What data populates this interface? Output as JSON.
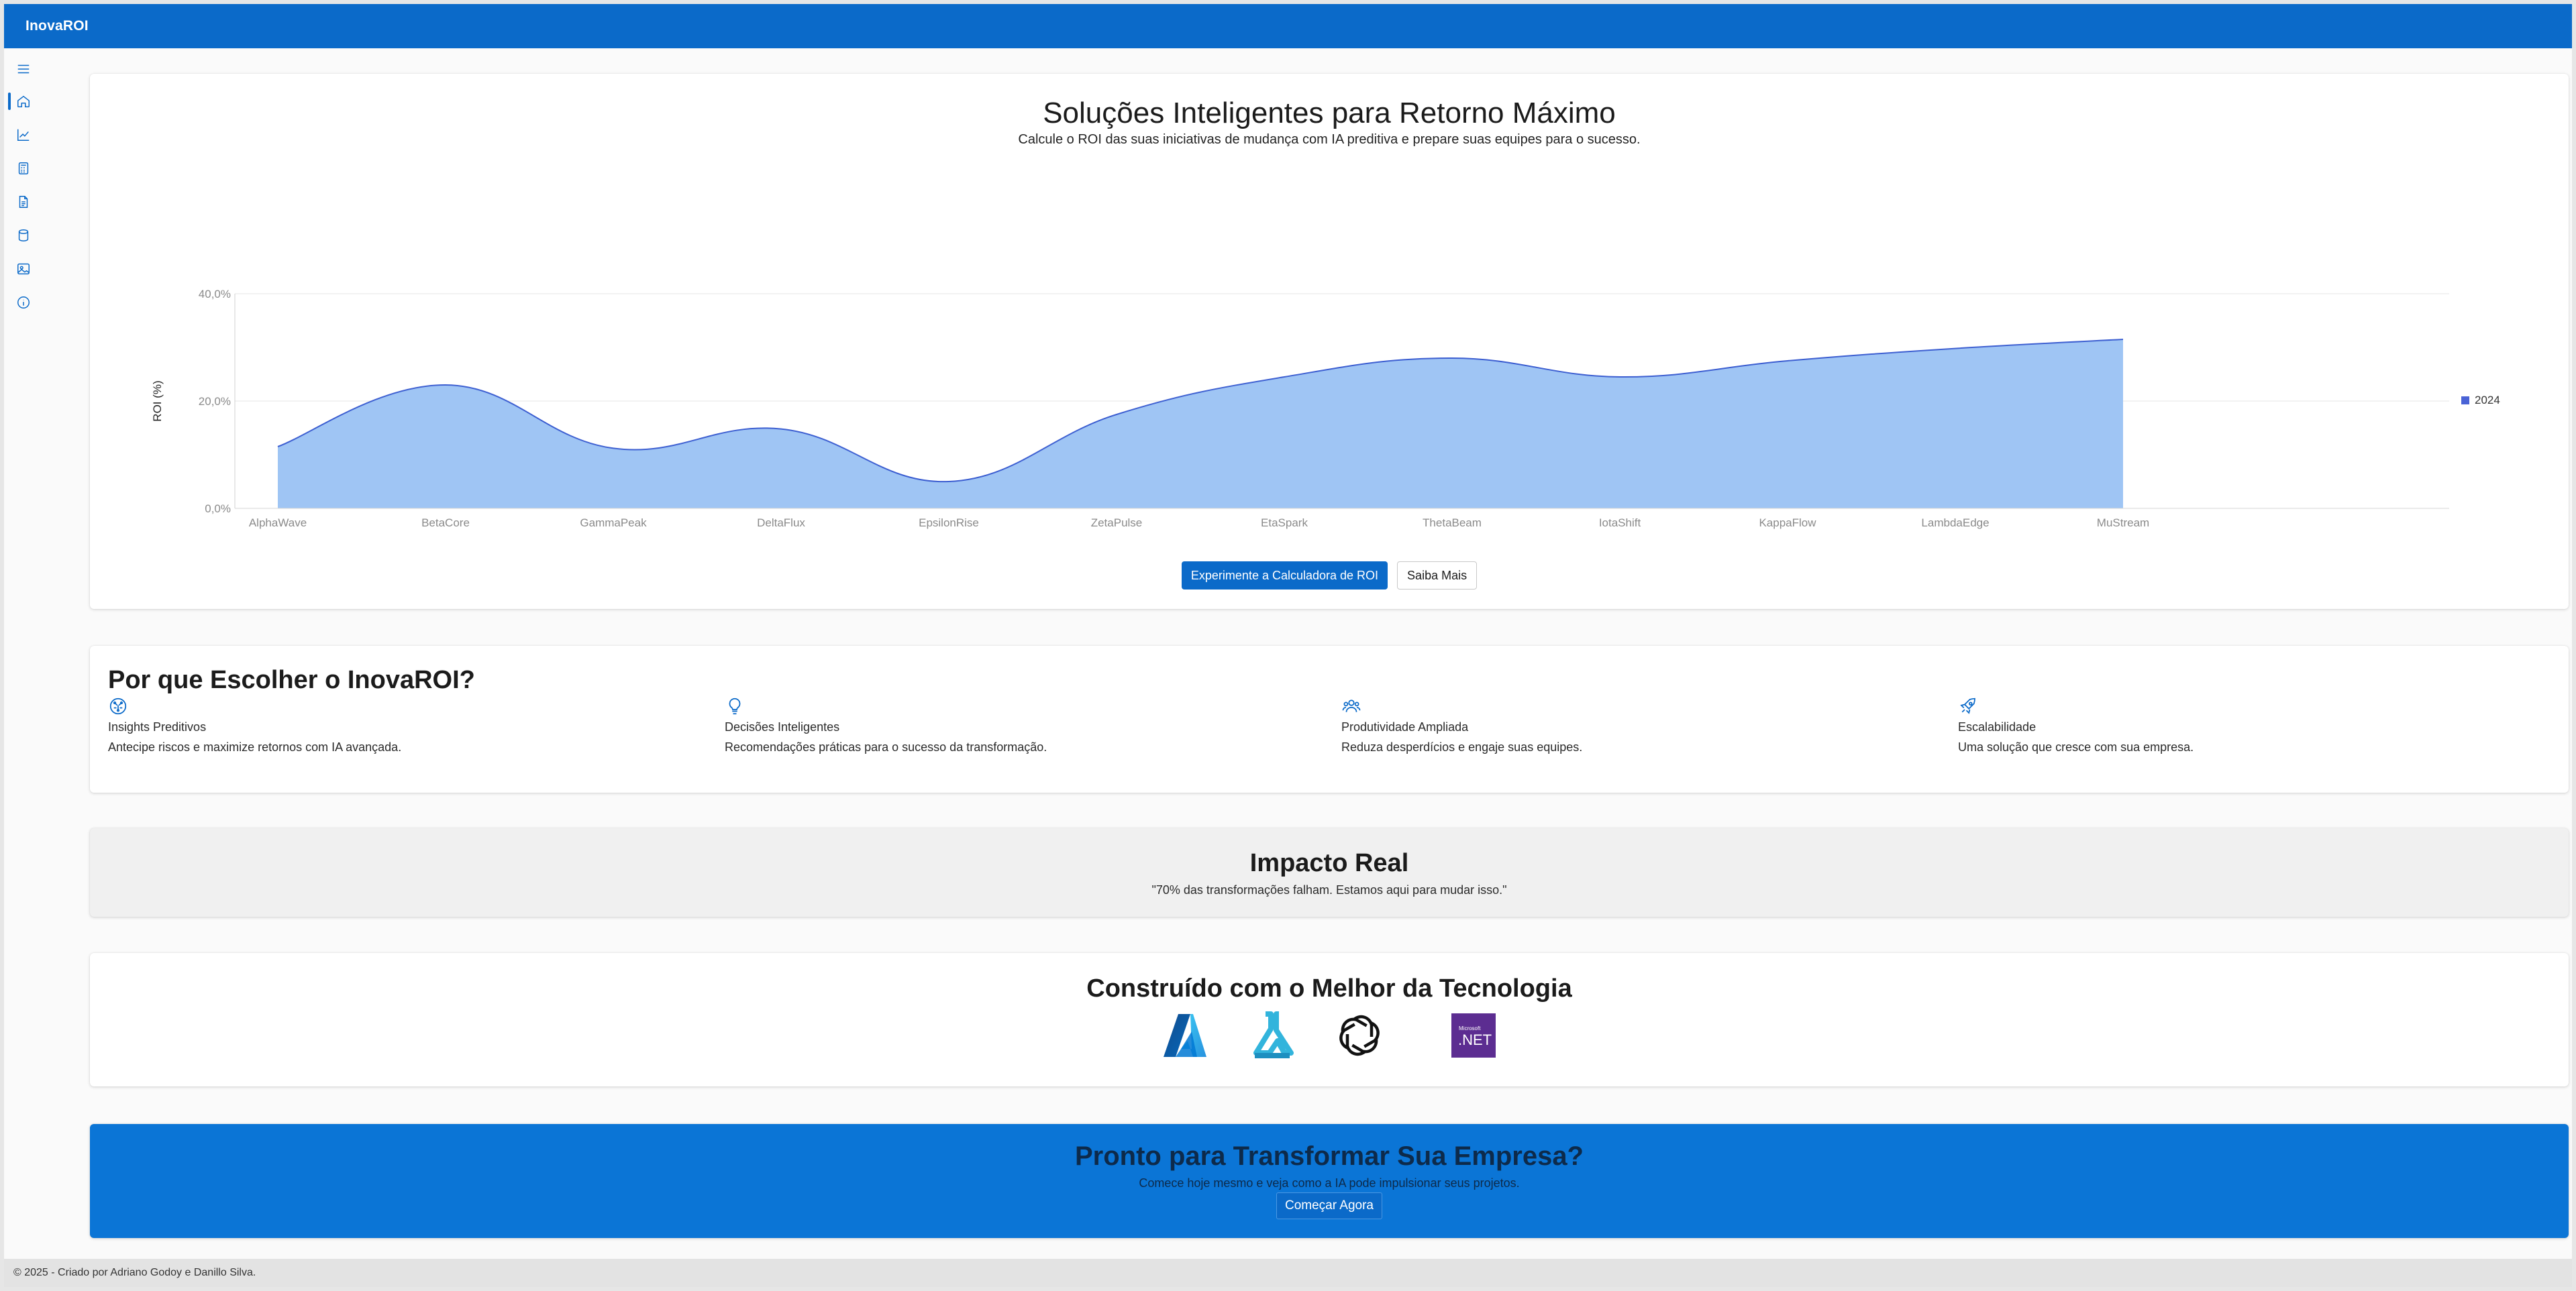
{
  "app": {
    "title": "InovaROI"
  },
  "rail": {
    "items": [
      {
        "icon": "hamburger-menu-icon"
      },
      {
        "icon": "home-icon",
        "active": true
      },
      {
        "icon": "line-chart-icon"
      },
      {
        "icon": "calculator-icon"
      },
      {
        "icon": "document-icon"
      },
      {
        "icon": "database-icon"
      },
      {
        "icon": "image-icon"
      },
      {
        "icon": "info-icon"
      }
    ]
  },
  "hero": {
    "title": "Soluções Inteligentes para Retorno Máximo",
    "subtitle": "Calcule o ROI das suas iniciativas de mudança com IA preditiva e prepare suas equipes para o sucesso.",
    "primary_button": "Experimente a Calculadora de ROI",
    "secondary_button": "Saiba Mais"
  },
  "chart_data": {
    "type": "area",
    "categories": [
      "AlphaWave",
      "BetaCore",
      "GammaPeak",
      "DeltaFlux",
      "EpsilonRise",
      "ZetaPulse",
      "EtaSpark",
      "ThetaBeam",
      "IotaShift",
      "KappaFlow",
      "LambdaEdge",
      "MuStream"
    ],
    "series": [
      {
        "name": "2024",
        "values": [
          11.5,
          23,
          11.2,
          14.8,
          5,
          17.5,
          24.5,
          28,
          24.5,
          27.5,
          29.8,
          31.5
        ]
      }
    ],
    "ylabel": "ROI (%)",
    "xlabel": "",
    "ylim": [
      0,
      40
    ],
    "yticks": [
      "0,0%",
      "20,0%",
      "40,0%"
    ],
    "ytick_values": [
      0,
      20,
      40
    ],
    "grid": true,
    "legend": "right",
    "fill_color": "#9fc5f4",
    "line_color": "#3d5fd1",
    "legend_color": "#4a63d6"
  },
  "why": {
    "title": "Por que Escolher o InovaROI?",
    "features": [
      {
        "icon": "brain-circuit-icon",
        "title": "Insights Preditivos",
        "desc": "Antecipe riscos e maximize retornos com IA avançada."
      },
      {
        "icon": "lightbulb-icon",
        "title": "Decisões Inteligentes",
        "desc": "Recomendações práticas para o sucesso da transformação."
      },
      {
        "icon": "people-icon",
        "title": "Produtividade Ampliada",
        "desc": "Reduza desperdícios e engaje suas equipes."
      },
      {
        "icon": "rocket-icon",
        "title": "Escalabilidade",
        "desc": "Uma solução que cresce com sua empresa."
      }
    ]
  },
  "impact": {
    "title": "Impacto Real",
    "quote": "\"70% das transformações falham. Estamos aqui para mudar isso.\""
  },
  "tech": {
    "title": "Construído com o Melhor da Tecnologia",
    "logos": [
      {
        "icon": "azure-logo-icon"
      },
      {
        "icon": "azure-ml-flask-icon"
      },
      {
        "icon": "openai-logo-icon"
      },
      {
        "icon": "dotnet-logo-icon",
        "small_text": "Microsoft",
        "text": ".NET"
      }
    ]
  },
  "cta": {
    "title": "Pronto para Transformar Sua Empresa?",
    "subtitle": "Comece hoje mesmo e veja como a IA pode impulsionar seus projetos.",
    "button": "Começar Agora"
  },
  "footer": {
    "text": "© 2025 - Criado por Adriano Godoy e Danillo Silva."
  }
}
